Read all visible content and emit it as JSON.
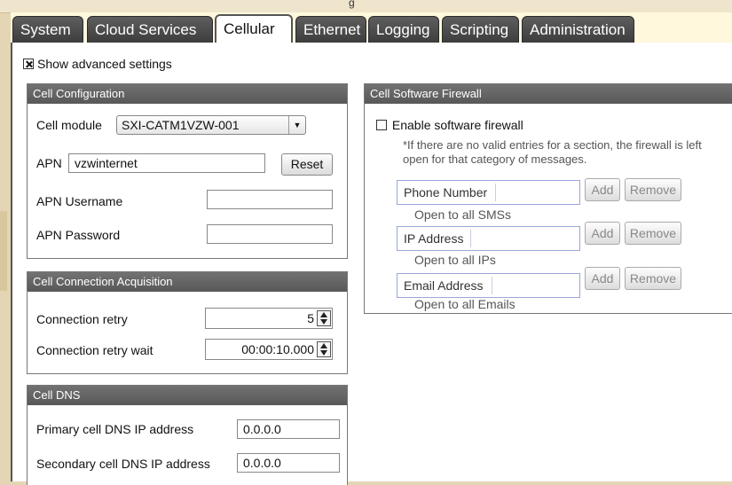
{
  "window": {
    "title": "g"
  },
  "tabs": [
    {
      "label": "System"
    },
    {
      "label": "Cloud Services"
    },
    {
      "label": "Cellular"
    },
    {
      "label": "Ethernet"
    },
    {
      "label": "Logging"
    },
    {
      "label": "Scripting"
    },
    {
      "label": "Administration"
    }
  ],
  "advanced": {
    "label": "Show advanced settings",
    "checked": true
  },
  "cell_config": {
    "title": "Cell Configuration",
    "module_label": "Cell module",
    "module_value": "SXI-CATM1VZW-001",
    "apn_label": "APN",
    "apn_value": "vzwinternet",
    "reset_label": "Reset",
    "apn_user_label": "APN Username",
    "apn_user_value": "",
    "apn_pass_label": "APN Password",
    "apn_pass_value": ""
  },
  "acquisition": {
    "title": "Cell Connection Acquisition",
    "retry_label": "Connection retry",
    "retry_value": "5",
    "wait_label": "Connection retry wait",
    "wait_value": "00:00:10.000"
  },
  "dns": {
    "title": "Cell DNS",
    "primary_label": "Primary cell DNS IP address",
    "primary_value": "0.0.0.0",
    "secondary_label": "Secondary cell DNS IP address",
    "secondary_value": "0.0.0.0"
  },
  "firewall": {
    "title": "Cell Software Firewall",
    "enable_label": "Enable software firewall",
    "enabled": false,
    "note": "*If there are no valid entries for a section, the firewall is left open for that category of messages.",
    "add_label": "Add",
    "remove_label": "Remove",
    "sections": [
      {
        "placeholder": "Phone Number",
        "status": "Open to all SMSs"
      },
      {
        "placeholder": "IP Address",
        "status": "Open to all IPs"
      },
      {
        "placeholder": "Email Address",
        "status": "Open to all Emails"
      }
    ]
  }
}
